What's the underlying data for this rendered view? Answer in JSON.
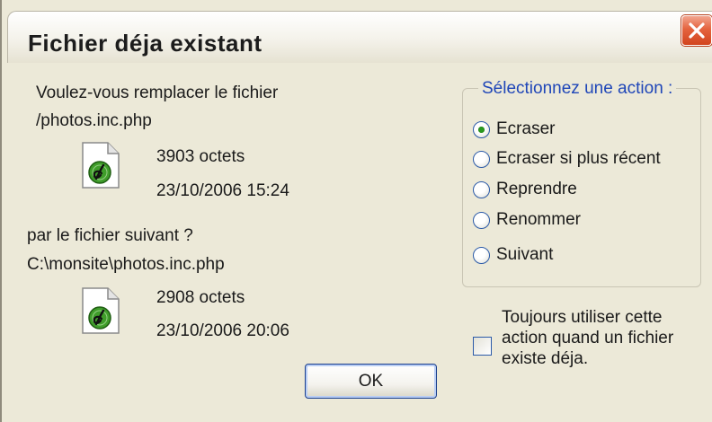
{
  "window": {
    "title": "Fichier déja existant",
    "close_icon": "close-icon"
  },
  "message": {
    "question_line1": "Voulez-vous remplacer le fichier",
    "existing_path": "/photos.inc.php",
    "question_line2": "par le fichier suivant ?",
    "new_path": "C:\\monsite\\photos.inc.php"
  },
  "existing_file": {
    "icon": "dreamweaver-php-file-icon",
    "size": "3903 octets",
    "date": "23/10/2006 15:24"
  },
  "new_file": {
    "icon": "dreamweaver-php-file-icon",
    "size": "2908 octets",
    "date": "23/10/2006 20:06"
  },
  "action_group": {
    "legend": "Sélectionnez une action :",
    "options": [
      {
        "label": "Ecraser",
        "checked": true
      },
      {
        "label": "Ecraser si plus récent",
        "checked": false
      },
      {
        "label": "Reprendre",
        "checked": false
      },
      {
        "label": "Renommer",
        "checked": false
      },
      {
        "label": "Suivant",
        "checked": false
      }
    ]
  },
  "always_use": {
    "label": "Toujours utiliser cette action quand un fichier existe déja.",
    "checked": false
  },
  "buttons": {
    "ok_label": "OK"
  },
  "colors": {
    "dialog_bg": "#ece9d8",
    "legend_text": "#1f46b8",
    "close_button": "#d2451e",
    "radio_dot": "#2a9a1e"
  }
}
